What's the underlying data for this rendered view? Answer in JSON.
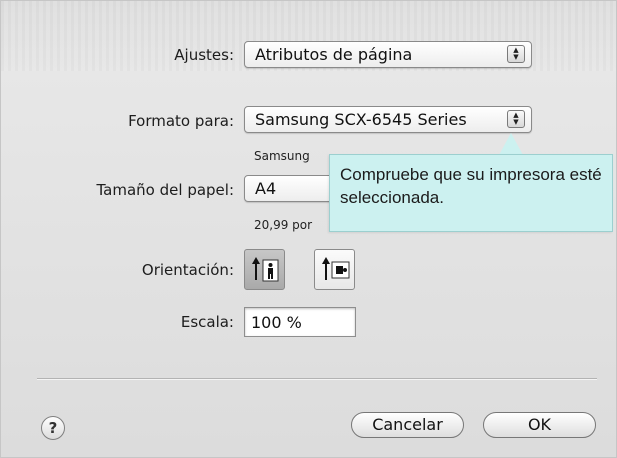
{
  "settings": {
    "label": "Ajustes:",
    "value": "Atributos de página"
  },
  "format_for": {
    "label": "Formato para:",
    "value": "Samsung SCX-6545 Series",
    "sub_text": "Samsung"
  },
  "paper_size": {
    "label": "Tamaño del papel:",
    "value": "A4",
    "dimensions_text": "20,99 por"
  },
  "orientation": {
    "label": "Orientación:",
    "options": [
      "portrait",
      "landscape"
    ],
    "selected": "portrait"
  },
  "scale": {
    "label": "Escala:",
    "value": "100 %"
  },
  "buttons": {
    "help": "?",
    "cancel": "Cancelar",
    "ok": "OK"
  },
  "callout": {
    "text": "Compruebe que su impresora esté seleccionada."
  },
  "colors": {
    "callout_bg": "#ccf1f0",
    "dialog_bg": "#e3e3e3"
  }
}
